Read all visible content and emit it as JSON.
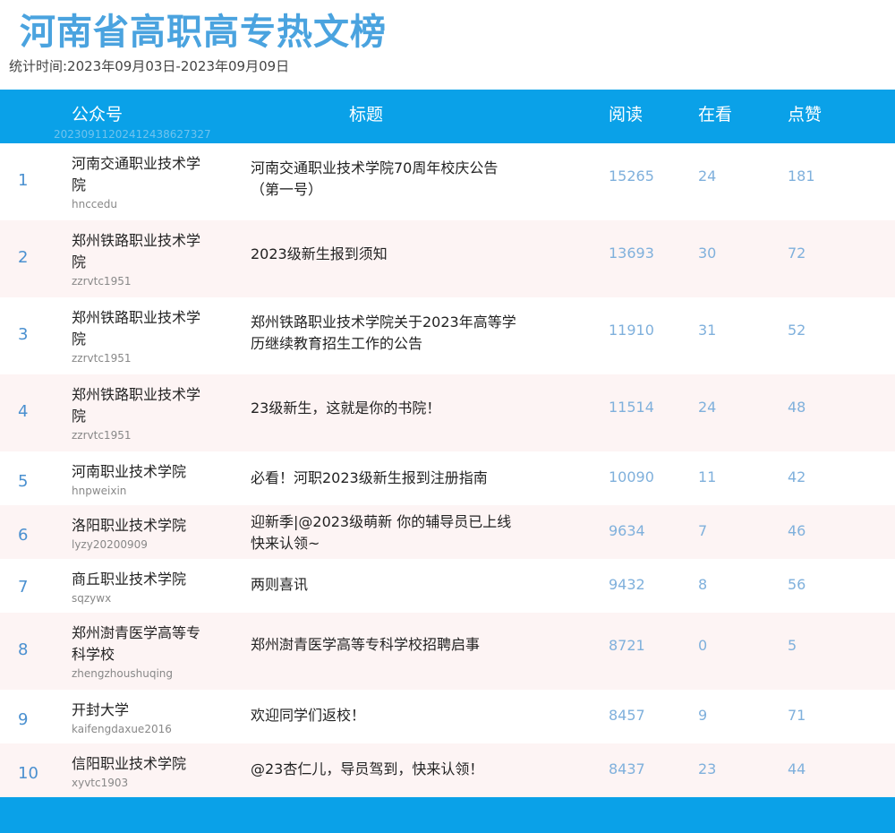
{
  "page": {
    "title": "河南省高职高专热文榜",
    "period": "统计时间:2023年09月03日-2023年09月09日",
    "watermark": "20230911202412438627327"
  },
  "table": {
    "headers": {
      "account": "公众号",
      "title": "标题",
      "reads": "阅读",
      "watching": "在看",
      "likes": "点赞"
    },
    "rows": [
      {
        "rank": "1",
        "name": "河南交通职业技术学院",
        "id": "hnccedu",
        "title": "河南交通职业技术学院70周年校庆公告（第一号）",
        "reads": "15265",
        "watching": "24",
        "likes": "181"
      },
      {
        "rank": "2",
        "name": "郑州铁路职业技术学院",
        "id": "zzrvtc1951",
        "title": "2023级新生报到须知",
        "reads": "13693",
        "watching": "30",
        "likes": "72"
      },
      {
        "rank": "3",
        "name": "郑州铁路职业技术学院",
        "id": "zzrvtc1951",
        "title": "郑州铁路职业技术学院关于2023年高等学历继续教育招生工作的公告",
        "reads": "11910",
        "watching": "31",
        "likes": "52"
      },
      {
        "rank": "4",
        "name": "郑州铁路职业技术学院",
        "id": "zzrvtc1951",
        "title": "23级新生，这就是你的书院！",
        "reads": "11514",
        "watching": "24",
        "likes": "48"
      },
      {
        "rank": "5",
        "name": "河南职业技术学院",
        "id": "hnpweixin",
        "title": "必看！河职2023级新生报到注册指南",
        "reads": "10090",
        "watching": "11",
        "likes": "42"
      },
      {
        "rank": "6",
        "name": "洛阳职业技术学院",
        "id": "lyzy20200909",
        "title": "迎新季|@2023级萌新 你的辅导员已上线快来认领~",
        "reads": "9634",
        "watching": "7",
        "likes": "46"
      },
      {
        "rank": "7",
        "name": "商丘职业技术学院",
        "id": "sqzywx",
        "title": "两则喜讯",
        "reads": "9432",
        "watching": "8",
        "likes": "56"
      },
      {
        "rank": "8",
        "name": "郑州澍青医学高等专科学校",
        "id": "zhengzhoushuqing",
        "title": "郑州澍青医学高等专科学校招聘启事",
        "reads": "8721",
        "watching": "0",
        "likes": "5"
      },
      {
        "rank": "9",
        "name": "开封大学",
        "id": "kaifengdaxue2016",
        "title": "欢迎同学们返校！",
        "reads": "8457",
        "watching": "9",
        "likes": "71"
      },
      {
        "rank": "10",
        "name": "信阳职业技术学院",
        "id": "xyvtc1903",
        "title": "@23杏仁儿，导员驾到，快来认领！",
        "reads": "8437",
        "watching": "23",
        "likes": "44"
      }
    ]
  },
  "colors": {
    "header_bg": "#0aa1e8",
    "title_color": "#4aa3df",
    "alt_row_bg": "#fdf4f4",
    "number_color": "#7fb0dc"
  }
}
